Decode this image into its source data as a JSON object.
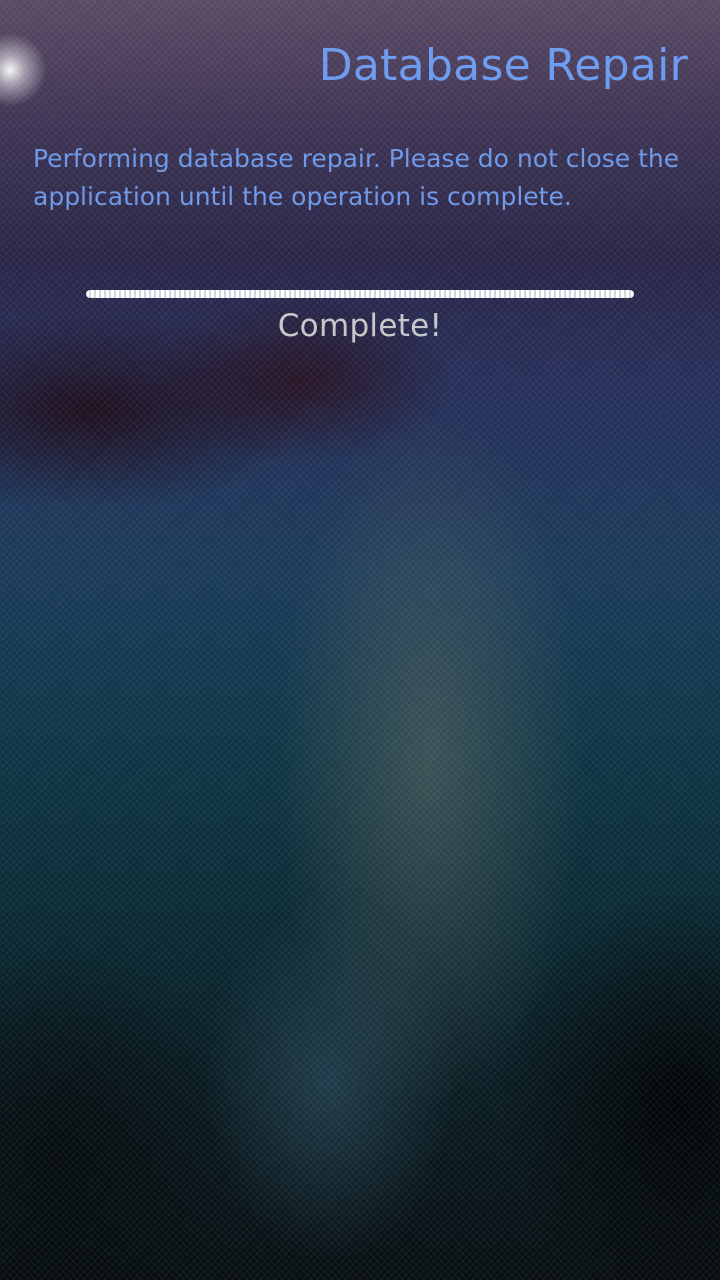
{
  "header": {
    "title": "Database Repair"
  },
  "main": {
    "description": "Performing database repair. Please do not close the application until the operation is complete.",
    "progress": {
      "value": 1.0
    },
    "status": "Complete!"
  },
  "colors": {
    "accent": "#6e9cf0",
    "status_text": "#c8c8cc",
    "progress_fill": "#ffffff"
  }
}
